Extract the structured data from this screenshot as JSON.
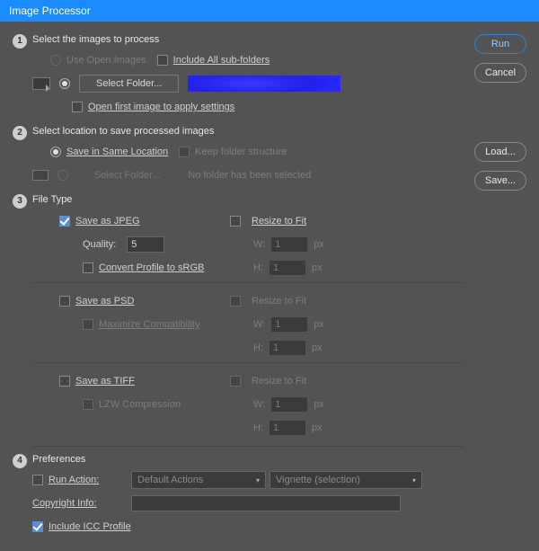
{
  "title": "Image Processor",
  "buttons": {
    "run": "Run",
    "cancel": "Cancel",
    "load": "Load...",
    "save": "Save..."
  },
  "sec1": {
    "title": "Select the images to process",
    "use_open": "Use Open Images",
    "include_sub": "Include All sub-folders",
    "select_folder": "Select Folder...",
    "open_first": "Open first image to apply settings"
  },
  "sec2": {
    "title": "Select location to save processed images",
    "same_loc": "Save in Same Location",
    "keep_struct": "Keep folder structure",
    "select_folder": "Select Folder...",
    "no_folder": "No folder has been selected"
  },
  "sec3": {
    "title": "File Type",
    "jpeg": {
      "save": "Save as JPEG",
      "quality": "Quality:",
      "quality_val": "5",
      "convert": "Convert Profile to sRGB",
      "resize": "Resize to Fit",
      "w": "W:",
      "h": "H:",
      "wv": "1",
      "hv": "1",
      "px": "px"
    },
    "psd": {
      "save": "Save as PSD",
      "max": "Maximize Compatibility",
      "resize": "Resize to Fit",
      "w": "W:",
      "h": "H:",
      "wv": "1",
      "hv": "1",
      "px": "px"
    },
    "tiff": {
      "save": "Save as TIFF",
      "lzw": "LZW Compression",
      "resize": "Resize to Fit",
      "w": "W:",
      "h": "H:",
      "wv": "1",
      "hv": "1",
      "px": "px"
    }
  },
  "sec4": {
    "title": "Preferences",
    "run_action": "Run Action:",
    "action_set": "Default Actions",
    "action": "Vignette (selection)",
    "copyright": "Copyright Info:",
    "icc": "Include ICC Profile"
  }
}
